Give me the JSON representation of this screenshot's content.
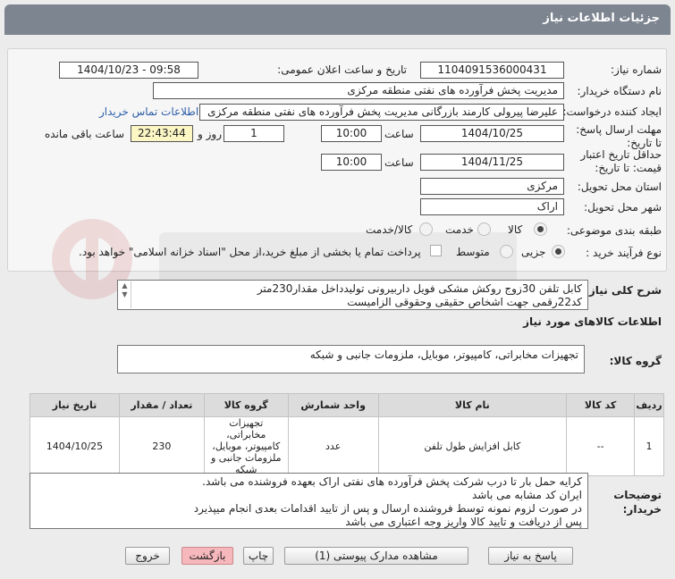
{
  "header": {
    "title": "جزئیات اطلاعات نیاز"
  },
  "form": {
    "need_number": {
      "label": "شماره نیاز:",
      "value": "1104091536000431"
    },
    "announce_datetime": {
      "label": "تاریخ و ساعت اعلان عمومی:",
      "value": "1404/10/23 - 09:58"
    },
    "buyer_org": {
      "label": "نام دستگاه خریدار:",
      "value": "مدیریت پخش فرآورده های نفتی منطقه مرکزی"
    },
    "requester": {
      "label": "ایجاد کننده درخواست:",
      "value": "علیرضا پیرولی کارمند بازرگانی مدیریت پخش فرآورده های نفتی منطقه مرکزی",
      "contact_link": "اطلاعات تماس خریدار"
    },
    "reply_deadline": {
      "label": "مهلت ارسال پاسخ: تا تاریخ:",
      "date": "1404/10/25",
      "time_label": "ساعت",
      "time": "10:00",
      "days": "1",
      "days_label": "روز و",
      "remaining": "22:43:44",
      "remaining_label": "ساعت باقی مانده"
    },
    "price_validity": {
      "label": "حداقل تاریخ اعتبار قیمت: تا تاریخ:",
      "date": "1404/11/25",
      "time_label": "ساعت",
      "time": "10:00"
    },
    "province": {
      "label": "استان محل تحویل:",
      "value": "مرکزی"
    },
    "city": {
      "label": "شهر محل تحویل:",
      "value": "اراک"
    },
    "category": {
      "label": "طبقه بندی موضوعی:",
      "options": [
        "کالا",
        "خدمت",
        "کالا/خدمت"
      ],
      "selected": "کالا"
    },
    "purchase_type": {
      "label": "نوع فرآیند خرید :",
      "options": [
        "جزیی",
        "متوسط"
      ],
      "selected": "جزیی",
      "checkbox_text": "پرداخت تمام یا بخشی از مبلغ خرید،از محل \"اسناد خزانه اسلامی\" خواهد بود."
    }
  },
  "summary": {
    "label": "شرح کلی نیاز:",
    "line1": "کابل تلفن 30زوج روکش مشکی فویل داربیرونی تولیدداخل مقدار230متر",
    "line2": "کد22رقمی  جهت اشخاص حقیقی وحقوقی الزامیست"
  },
  "goods_info_title": "اطلاعات کالاهای مورد نیاز",
  "goods_group": {
    "label": "گروه کالا:",
    "value": "تجهیزات مخابراتی، کامپیوتر، موبایل، ملزومات جانبی و شبکه"
  },
  "table": {
    "headers": [
      "ردیف",
      "کد کالا",
      "نام کالا",
      "واحد شمارش",
      "گروه کالا",
      "تعداد / مقدار",
      "تاریخ نیاز"
    ],
    "rows": [
      {
        "row": "1",
        "code": "--",
        "name": "کابل افزایش طول تلفن",
        "unit": "عدد",
        "group": "تجهیزات مخابراتی، کامپیوتر، موبایل، ملزومات جانبی و شبکه",
        "qty": "230",
        "date": "1404/10/25"
      }
    ]
  },
  "buyer_notes": {
    "label": "توضیحات خریدار:",
    "lines": [
      "کرایه حمل بار تا درب شرکت  پخش فرآورده های نفتی اراک بعهده فروشنده می باشد.",
      "ایران کد مشابه می باشد",
      "در صورت لزوم نمونه توسط فروشنده ارسال و پس از تایید اقدامات بعدی انجام میپذیرد",
      "پس از دریافت و تایید کالا واریز وجه اعتباری می باشد"
    ]
  },
  "buttons": {
    "reply": "پاسخ به نیاز",
    "attachments": "مشاهده مدارک پیوستی (1)",
    "print": "چاپ",
    "back": "بازگشت",
    "exit": "خروج"
  },
  "colors": {
    "header_bg": "#7d8590",
    "link": "#2d5ea8",
    "remaining_bg": "#fbf6c4",
    "exit_bg": "#f6b8bd"
  }
}
